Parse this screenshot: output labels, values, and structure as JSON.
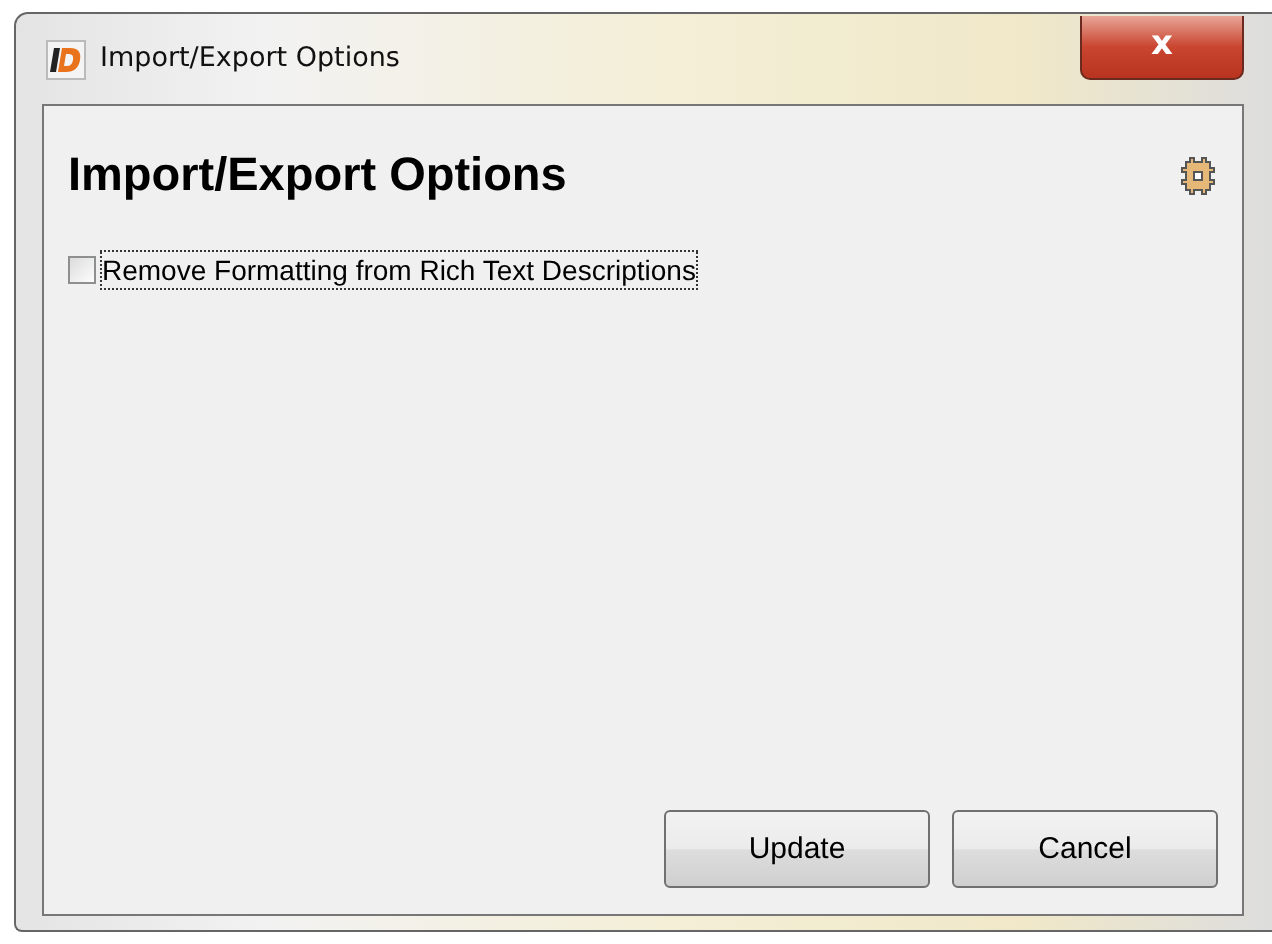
{
  "window": {
    "title": "Import/Export Options",
    "close_label": "x"
  },
  "heading": "Import/Export Options",
  "options": [
    {
      "label": "Remove Formatting from Rich Text Descriptions",
      "checked": false,
      "focused": true
    }
  ],
  "buttons": [
    {
      "label": "Update"
    },
    {
      "label": "Cancel"
    }
  ]
}
